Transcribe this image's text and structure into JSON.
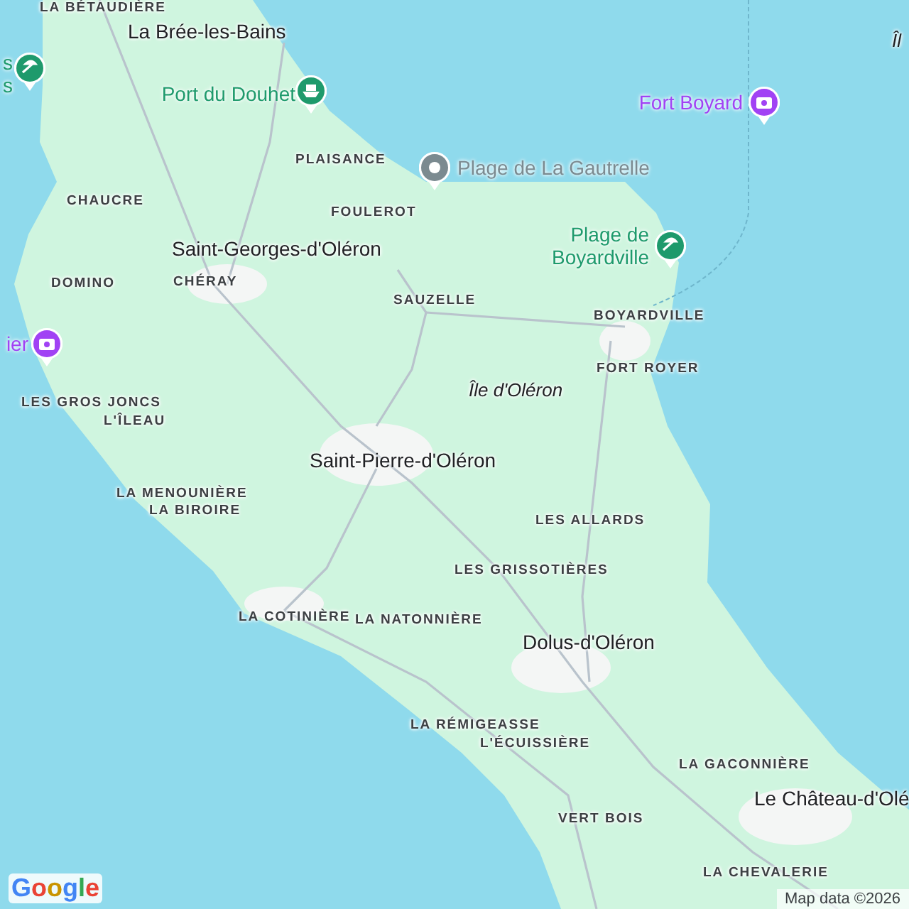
{
  "map": {
    "places": [
      {
        "text": "LA BÉTAUDIÈRE",
        "kind": "village"
      },
      {
        "text": "La Brée-les-Bains",
        "kind": "town"
      },
      {
        "text": "Îl",
        "kind": "island"
      },
      {
        "text": "PLAISANCE",
        "kind": "village"
      },
      {
        "text": "CHAUCRE",
        "kind": "village"
      },
      {
        "text": "FOULEROT",
        "kind": "village"
      },
      {
        "text": "Saint-Georges-d'Oléron",
        "kind": "town"
      },
      {
        "text": "CHÉRAY",
        "kind": "village"
      },
      {
        "text": "DOMINO",
        "kind": "village"
      },
      {
        "text": "SAUZELLE",
        "kind": "village"
      },
      {
        "text": "BOYARDVILLE",
        "kind": "village"
      },
      {
        "text": "FORT ROYER",
        "kind": "village"
      },
      {
        "text": "Île d'Oléron",
        "kind": "island"
      },
      {
        "text": "LES GROS JONCS",
        "kind": "village"
      },
      {
        "text": "L'ÎLEAU",
        "kind": "village"
      },
      {
        "text": "Saint-Pierre-d'Oléron",
        "kind": "town"
      },
      {
        "text": "LA MENOUNIÈRE",
        "kind": "village"
      },
      {
        "text": "LA BIROIRE",
        "kind": "village"
      },
      {
        "text": "LES ALLARDS",
        "kind": "village"
      },
      {
        "text": "LES GRISSOTIÈRES",
        "kind": "village"
      },
      {
        "text": "LA COTINIÈRE",
        "kind": "village"
      },
      {
        "text": "LA NATONNIÈRE",
        "kind": "village"
      },
      {
        "text": "Dolus-d'Oléron",
        "kind": "town"
      },
      {
        "text": "LA RÉMIGEASSE",
        "kind": "village"
      },
      {
        "text": "L'ÉCUISSIÈRE",
        "kind": "village"
      },
      {
        "text": "LA GACONNIÈRE",
        "kind": "village"
      },
      {
        "text": "Le Château-d'Olé",
        "kind": "town"
      },
      {
        "text": "VERT BOIS",
        "kind": "village"
      },
      {
        "text": "LA CHEVALERIE",
        "kind": "village"
      }
    ],
    "pois": [
      {
        "lines": [
          "s",
          "s"
        ],
        "kind": "beach",
        "color": "#1e9a6c"
      },
      {
        "lines": [
          "Port du Douhet"
        ],
        "kind": "ferry",
        "color": "#1e9a6c"
      },
      {
        "lines": [
          "Fort Boyard"
        ],
        "kind": "camera",
        "color": "#a142f4"
      },
      {
        "lines": [
          "Plage de La Gautrelle"
        ],
        "kind": "place",
        "color": "#7b8a90"
      },
      {
        "lines": [
          "Plage de",
          "Boyardville"
        ],
        "kind": "beach",
        "color": "#1e9a6c"
      },
      {
        "lines": [
          "ier"
        ],
        "kind": "camera",
        "color": "#a142f4"
      }
    ],
    "logo": "Google",
    "attribution": "Map data ©2026"
  }
}
